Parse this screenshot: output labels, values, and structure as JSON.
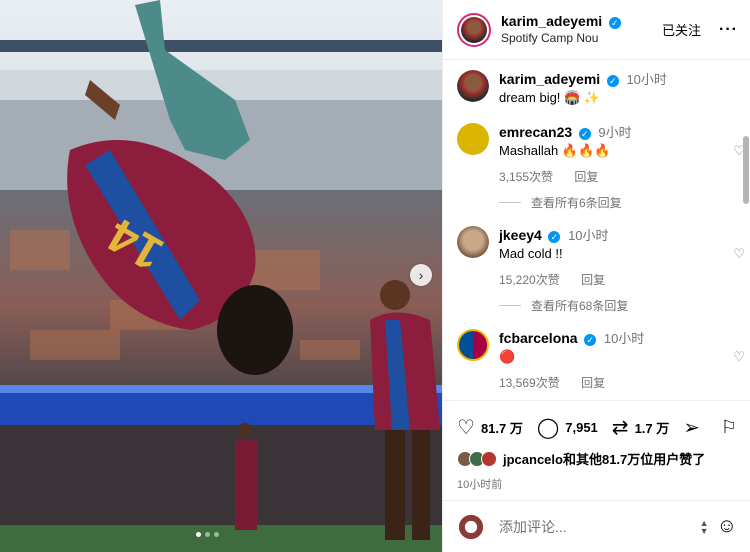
{
  "post": {
    "author": "karim_adeyemi",
    "location": "Spotify Camp Nou",
    "follow_status": "已关注",
    "more": "···",
    "caption_time": "10小时",
    "caption": "dream big! 🏟️ ✨"
  },
  "comments": [
    {
      "user": "emrecan23",
      "time": "9小时",
      "text": "Mashallah 🔥🔥🔥",
      "likes": "3,155次赞",
      "reply": "回复",
      "more_replies": "查看所有6条回复",
      "avatar_color": "#d9b400"
    },
    {
      "user": "jkeey4",
      "time": "10小时",
      "text": "Mad cold !!",
      "likes": "15,220次赞",
      "reply": "回复",
      "more_replies": "查看所有68条回复",
      "avatar_color": "#c9a88a"
    },
    {
      "user": "fcbarcelona",
      "time": "10小时",
      "text": "🔴",
      "likes": "13,569次赞",
      "reply": "回复",
      "avatar_color": "#a50044"
    }
  ],
  "stats": {
    "likes": "81.7 万",
    "comments": "7,951",
    "reposts": "1.7 万",
    "liked_by": "jpcancelo和其他81.7万位用户赞了",
    "posted_ago": "10小时前"
  },
  "composer": {
    "placeholder": "添加评论..."
  },
  "icons": {
    "heart": "heart-icon",
    "comment": "comment-icon",
    "repost": "repost-icon",
    "share": "share-icon",
    "save": "bookmark-icon",
    "emoji": "emoji-icon"
  },
  "colors": {
    "verified": "#0095f6",
    "secondary_text": "#737373",
    "blaugrana_blue": "#004d98",
    "blaugrana_red": "#a50044"
  }
}
